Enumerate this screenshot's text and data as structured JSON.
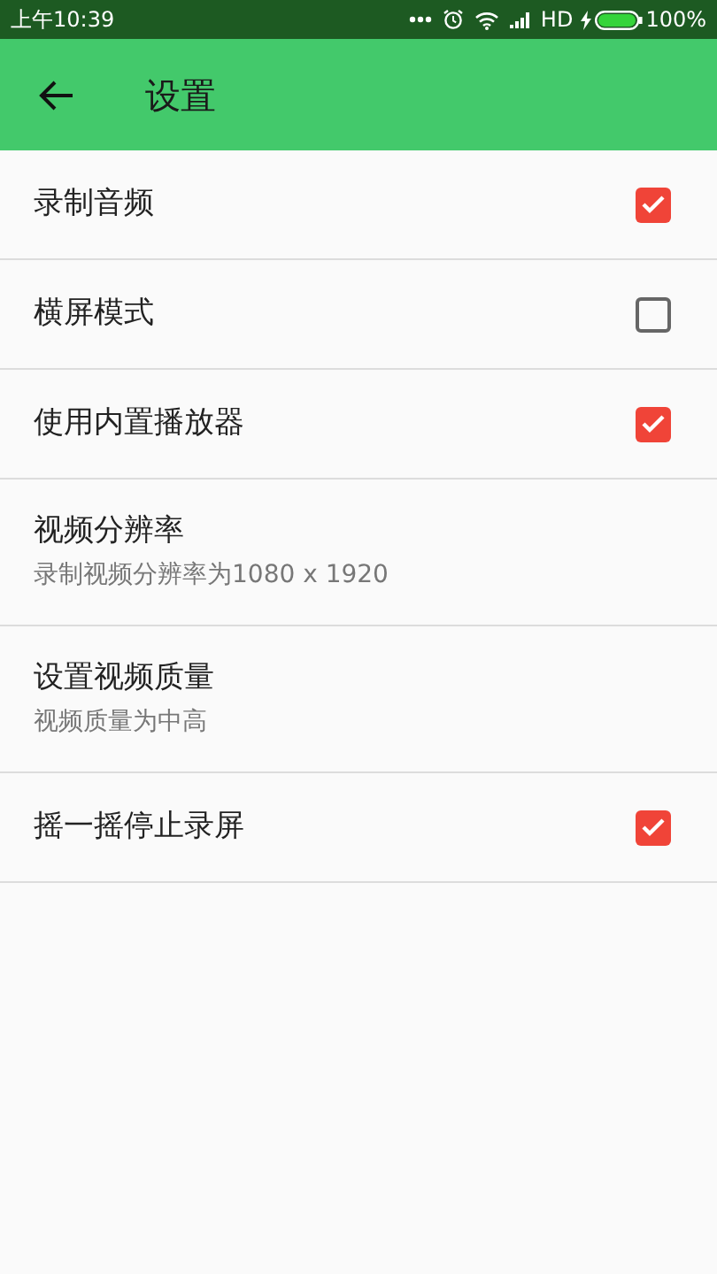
{
  "status_bar": {
    "time": "上午10:39",
    "network": "HD",
    "battery": "100%"
  },
  "app_bar": {
    "title": "设置"
  },
  "settings": [
    {
      "kind": "checkbox",
      "title": "录制音频",
      "checked": true
    },
    {
      "kind": "checkbox",
      "title": "横屏模式",
      "checked": false
    },
    {
      "kind": "checkbox",
      "title": "使用内置播放器",
      "checked": true
    },
    {
      "kind": "detail",
      "title": "视频分辨率",
      "subtitle": "录制视频分辨率为1080 x 1920"
    },
    {
      "kind": "detail",
      "title": "设置视频质量",
      "subtitle": "视频质量为中高"
    },
    {
      "kind": "checkbox",
      "title": "摇一摇停止录屏",
      "checked": true
    }
  ]
}
